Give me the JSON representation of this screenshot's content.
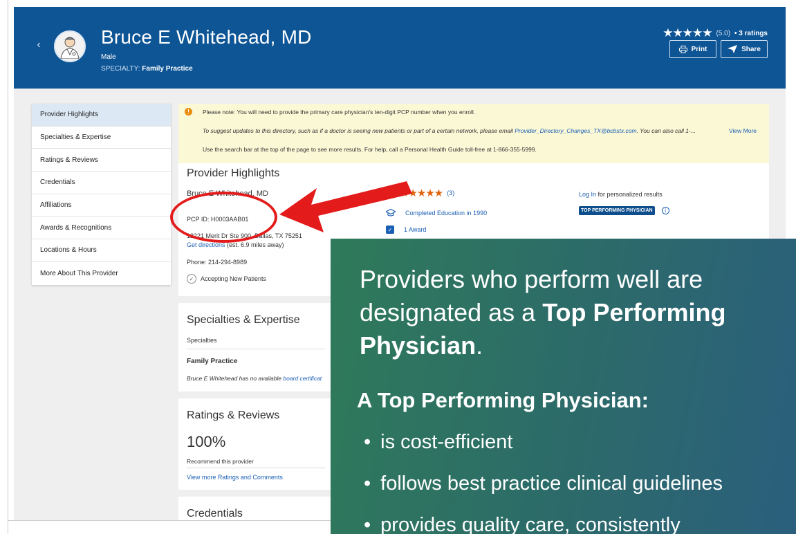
{
  "header": {
    "name": "Bruce E Whitehead, MD",
    "gender": "Male",
    "specialty_label": "SPECIALTY: ",
    "specialty_value": "Family Practice",
    "stars": "★★★★★",
    "score": "(5.0)",
    "ratings": "• 3 ratings",
    "print_label": "Print",
    "share_label": "Share",
    "back_glyph": "‹"
  },
  "sidenav": {
    "items": [
      {
        "label": "Provider Highlights"
      },
      {
        "label": "Specialties & Expertise"
      },
      {
        "label": "Ratings & Reviews"
      },
      {
        "label": "Credentials"
      },
      {
        "label": "Affiliations"
      },
      {
        "label": "Awards & Recognitions"
      },
      {
        "label": "Locations & Hours"
      },
      {
        "label": "More About This Provider"
      }
    ]
  },
  "notice": {
    "icon": "!",
    "line1": "Please note: You will need to provide the primary care physician's ten-digit PCP number when you enroll.",
    "line2_pre": "To suggest updates to this directory, such as if a doctor is seeing new patients or part of a certain network, please email ",
    "line2_email": "Provider_Directory_Changes_TX@bcbstx.com",
    "line2_post": ". You can also call 1-...",
    "view_more": "View More",
    "line3": "Use the search bar at the top of the page to see more results. For help, call a Personal Health Guide toll-free at 1-866-355-5999."
  },
  "highlights": {
    "title": "Provider Highlights",
    "name": "Bruce E Whitehead, MD",
    "pcp": "PCP ID: H0003AAB01",
    "address": "12221 Merit Dr Ste 900, Dallas, TX 75251",
    "directions_link": "Get directions",
    "directions_note": " (est. 6.9 miles away)",
    "phone": "Phone: 214-294-8989",
    "accepting": "Accepting New Patients",
    "stars": "★★★★★",
    "review_count": "(3)",
    "education": "Completed Education in 1990",
    "award": "1 Award",
    "login_link": "Log In",
    "login_suffix": " for personalized results",
    "badge": "TOP PERFORMING PHYSICIAN",
    "info_glyph": "i"
  },
  "specialties": {
    "title": "Specialties & Expertise",
    "subtitle": "Specialties",
    "family": "Family Practice",
    "note_pre": "Bruce E Whitehead has no available ",
    "note_link": "board certificat"
  },
  "ratings": {
    "title": "Ratings & Reviews",
    "percent": "100%",
    "recommend": "Recommend this provider",
    "link": "View more Ratings and Comments"
  },
  "credentials": {
    "title": "Credentials"
  },
  "overlay": {
    "line1": "Providers who perform well are",
    "line2_pre": "designated as a ",
    "line2_bold": "Top Performing",
    "line3_bold": "Physician",
    "line3_post": ".",
    "heading": "A Top Performing Physician:",
    "bullets": [
      "is cost-efficient",
      "follows best practice clinical guidelines",
      "provides quality care, consistently"
    ]
  }
}
